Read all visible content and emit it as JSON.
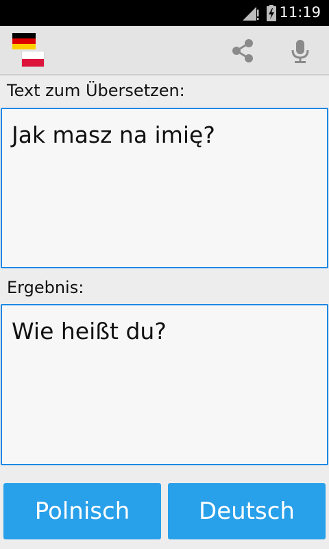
{
  "status_bar": {
    "time": "11:19",
    "icons": [
      "signal-icon",
      "battery-charging-icon"
    ]
  },
  "action_bar": {
    "source_flag": "germany-flag-icon",
    "target_flag": "poland-flag-icon",
    "actions": [
      "share-icon",
      "microphone-icon"
    ],
    "icon_color": "#8a8a8a"
  },
  "source": {
    "label": "Text zum Übersetzen:",
    "text": "Jak masz na imię?"
  },
  "result": {
    "label": "Ergebnis:",
    "text": "Wie heißt du?"
  },
  "buttons": {
    "left_label": "Polnisch",
    "right_label": "Deutsch"
  },
  "colors": {
    "accent": "#29a0ea",
    "textbox_border": "#1e88e5",
    "background": "#ededed"
  }
}
